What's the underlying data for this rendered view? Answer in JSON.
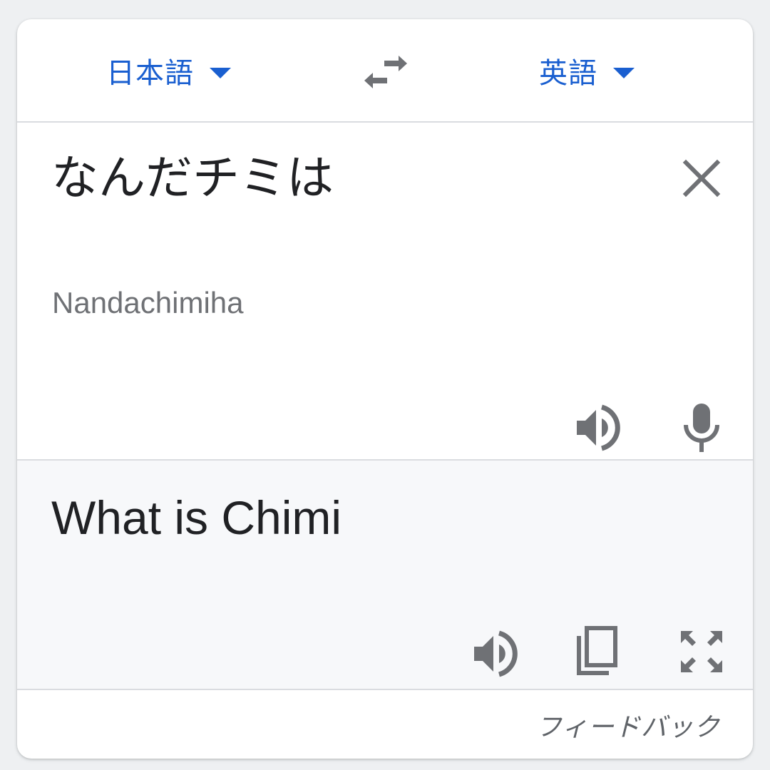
{
  "lang_bar": {
    "source_lang": "日本語",
    "target_lang": "英語"
  },
  "source": {
    "text": "なんだチミは",
    "romanization": "Nandachimiha"
  },
  "target": {
    "text": "What is Chimi"
  },
  "footer": {
    "feedback_label": "フィードバック"
  },
  "icons": {
    "swap": "swap-horiz-icon",
    "clear": "close-icon",
    "source_speaker": "volume-up-icon",
    "mic": "mic-icon",
    "target_speaker": "volume-up-icon",
    "copy": "copy-icon",
    "fullscreen": "fullscreen-icon"
  },
  "colors": {
    "accent": "#1a5fd0",
    "icon": "#6f7175",
    "text": "#202124",
    "target_bg": "#f7f8fa"
  }
}
